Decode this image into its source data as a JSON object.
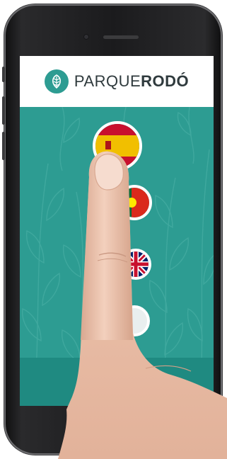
{
  "brand": {
    "name_light": "PARQUE",
    "name_bold": "RODÓ",
    "logo_icon": "leaf-icon",
    "accent": "#2d9c92"
  },
  "languages": [
    {
      "name": "spanish-flag-icon"
    },
    {
      "name": "portuguese-flag-icon"
    },
    {
      "name": "english-flag-icon"
    },
    {
      "name": "language-flag-icon"
    }
  ]
}
